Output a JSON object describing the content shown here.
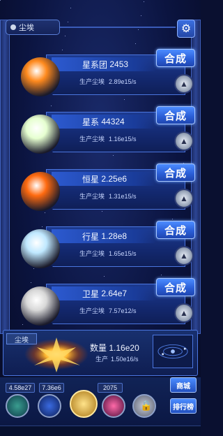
{
  "header": {
    "dust_label": "尘埃",
    "settings_icon": "gear-icon"
  },
  "rows": [
    {
      "name": "星系团",
      "count": "2453",
      "prod_label": "生产尘埃",
      "rate": "2.89e15/s",
      "merge_label": "合成",
      "planet": "galaxy-cluster",
      "color": "#ff8a1e"
    },
    {
      "name": "星系",
      "count": "44324",
      "prod_label": "生产尘埃",
      "rate": "1.16e15/s",
      "merge_label": "合成",
      "planet": "galaxy",
      "color": "#e6ffd0"
    },
    {
      "name": "恒星",
      "count": "2.25e6",
      "prod_label": "生产尘埃",
      "rate": "1.31e15/s",
      "merge_label": "合成",
      "planet": "star",
      "color": "#ff6a10"
    },
    {
      "name": "行星",
      "count": "1.28e8",
      "prod_label": "生产尘埃",
      "rate": "1.65e15/s",
      "merge_label": "合成",
      "planet": "planet",
      "color": "#bfe8ff"
    },
    {
      "name": "卫星",
      "count": "2.64e7",
      "prod_label": "生产尘埃",
      "rate": "7.57e12/s",
      "merge_label": "合成",
      "planet": "moon",
      "color": "#d8d8d8"
    }
  ],
  "dust_panel": {
    "title": "尘埃",
    "qty_label": "数量",
    "qty": "1.16e20",
    "prod_label": "生产",
    "rate": "1.50e16/s"
  },
  "bottom": {
    "stats": [
      "4.58e27",
      "7.36e6",
      "2075"
    ],
    "side_buttons": [
      "商城",
      "排行榜"
    ]
  }
}
